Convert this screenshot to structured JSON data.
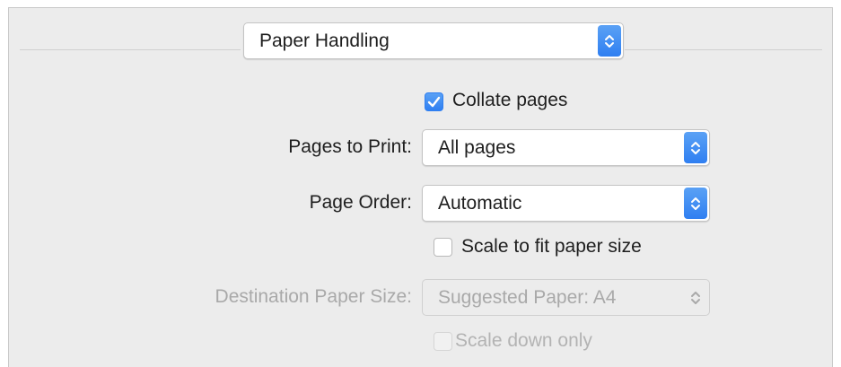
{
  "section_selector": {
    "value": "Paper Handling"
  },
  "collate": {
    "label": "Collate pages",
    "checked": true
  },
  "pages_to_print": {
    "label": "Pages to Print:",
    "value": "All pages"
  },
  "page_order": {
    "label": "Page Order:",
    "value": "Automatic"
  },
  "scale_to_fit": {
    "label": "Scale to fit paper size",
    "checked": false
  },
  "destination_paper_size": {
    "label": "Destination Paper Size:",
    "value": "Suggested Paper: A4",
    "enabled": false
  },
  "scale_down_only": {
    "label": "Scale down only",
    "checked": false,
    "enabled": false
  },
  "colors": {
    "accent": "#3a87f2",
    "panel_background": "#ececec",
    "disabled_text": "#a9a9a9"
  },
  "icons": {
    "popup_arrows": "up-down-chevron-icon",
    "checkmark": "checkmark-icon"
  }
}
